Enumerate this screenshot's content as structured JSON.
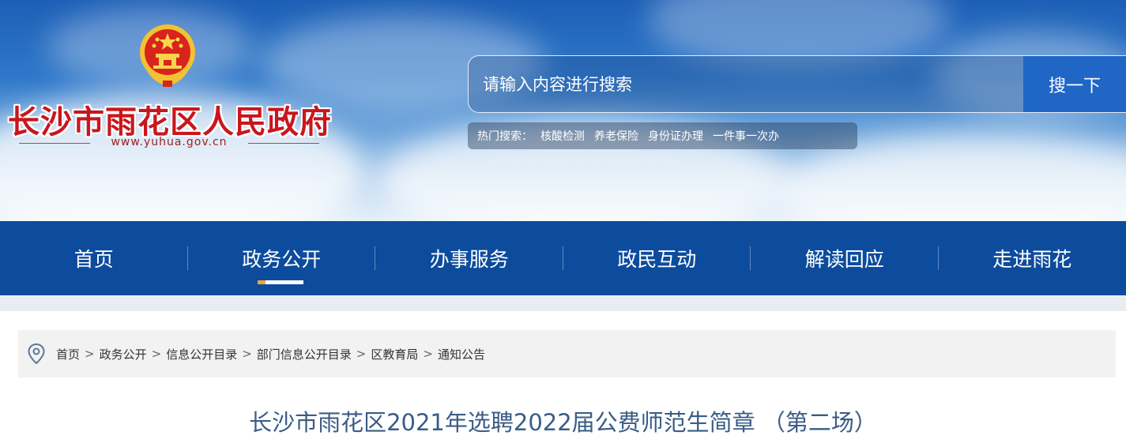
{
  "site": {
    "title": "长沙市雨花区人民政府",
    "url": "www.yuhua.gov.cn",
    "emblem_icon": "national-emblem"
  },
  "search": {
    "placeholder": "请输入内容进行搜索",
    "button_label": "搜一下"
  },
  "hot_search": {
    "label": "热门搜索：",
    "items": [
      "核酸检测",
      "养老保险",
      "身份证办理",
      "一件事一次办"
    ]
  },
  "nav": {
    "items": [
      {
        "label": "首页"
      },
      {
        "label": "政务公开",
        "active": true
      },
      {
        "label": "办事服务"
      },
      {
        "label": "政民互动"
      },
      {
        "label": "解读回应"
      },
      {
        "label": "走进雨花"
      }
    ]
  },
  "breadcrumb": {
    "icon": "location-pin-icon",
    "separator": ">",
    "items": [
      "首页",
      "政务公开",
      "信息公开目录",
      "部门信息公开目录",
      "区教育局",
      "通知公告"
    ]
  },
  "article": {
    "title": "长沙市雨花区2021年选聘2022届公费师范生简章 （第二场）"
  },
  "colors": {
    "nav_bg": "#0d4c9d",
    "search_button": "#1f66c7",
    "title_red": "#c9161d",
    "article_title": "#3a5c86",
    "active_accent": "#f0a53a"
  }
}
